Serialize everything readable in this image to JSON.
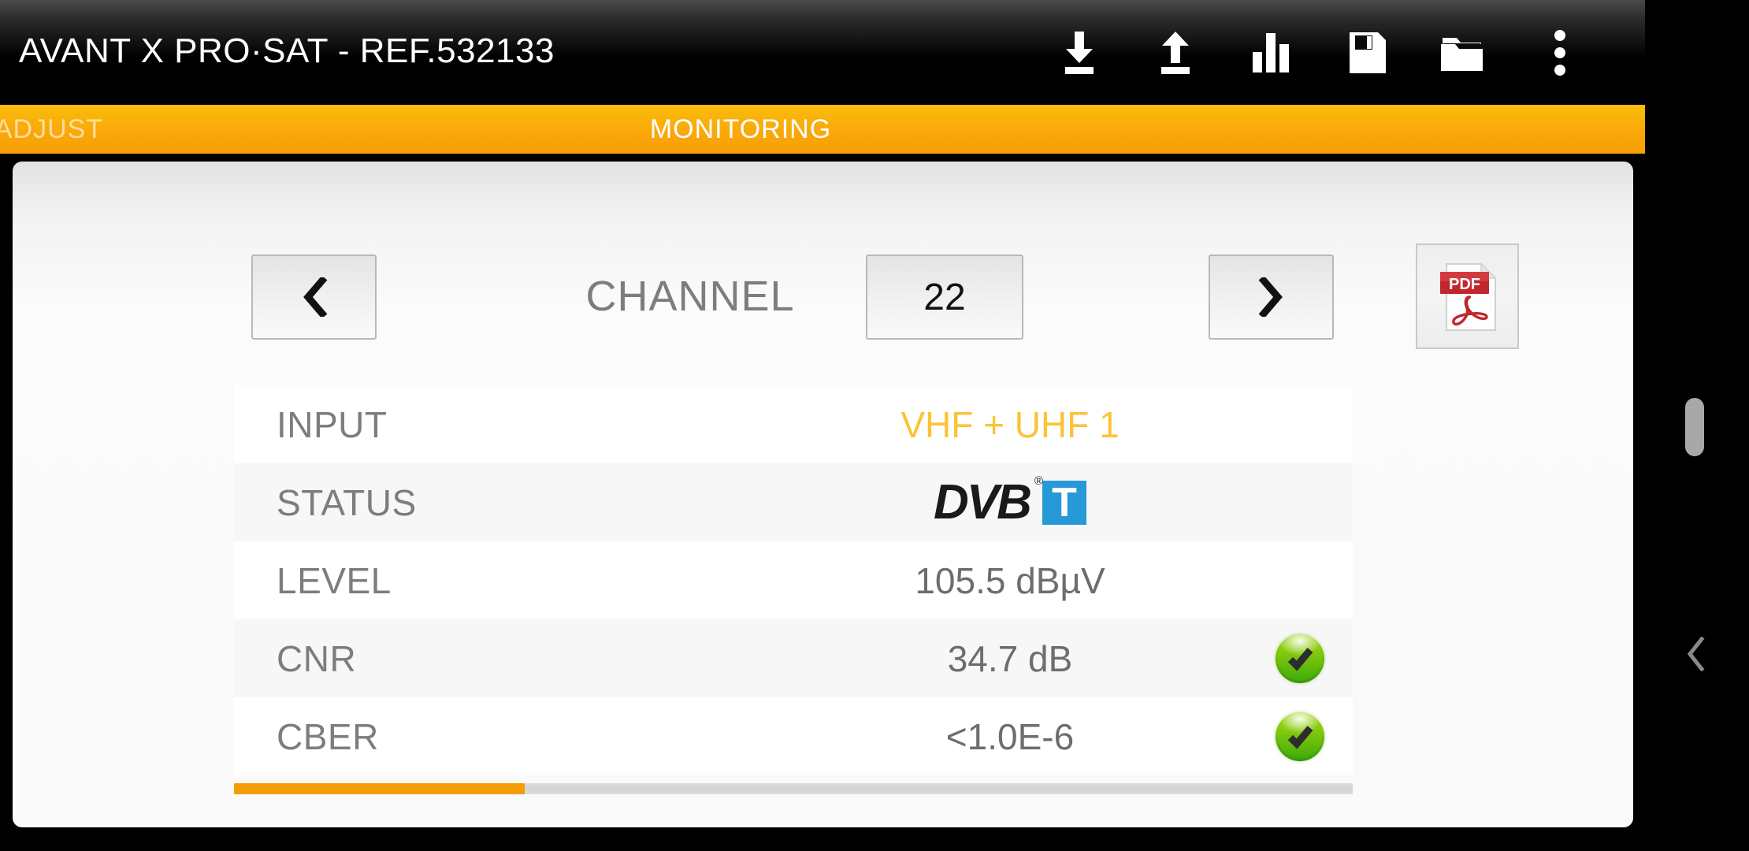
{
  "appbar": {
    "title": "AVANT X  PRO·SAT - REF.532133",
    "actions": [
      {
        "name": "download-icon",
        "label": "Download"
      },
      {
        "name": "upload-icon",
        "label": "Upload"
      },
      {
        "name": "bar-chart-icon",
        "label": "Spectrum"
      },
      {
        "name": "save-icon",
        "label": "Save"
      },
      {
        "name": "folder-icon",
        "label": "Open"
      },
      {
        "name": "more-vert-icon",
        "label": "More options"
      }
    ]
  },
  "tabs": [
    {
      "label": "ADJUST",
      "active": false
    },
    {
      "label": "MONITORING",
      "active": true
    }
  ],
  "channel": {
    "prev_label": "‹",
    "label": "CHANNEL",
    "value": "22",
    "next_label": "›",
    "pdf_label": "PDF"
  },
  "table": {
    "rows": [
      {
        "label": "INPUT",
        "value": "VHF + UHF 1",
        "accent": true,
        "badge": false,
        "logo": false
      },
      {
        "label": "STATUS",
        "value": "DVB-T",
        "accent": false,
        "badge": false,
        "logo": true
      },
      {
        "label": "LEVEL",
        "value": "105.5 dBµV",
        "accent": false,
        "badge": false,
        "logo": false
      },
      {
        "label": "CNR",
        "value": "34.7 dB",
        "accent": false,
        "badge": true,
        "logo": false
      },
      {
        "label": "CBER",
        "value": "<1.0E-6",
        "accent": false,
        "badge": true,
        "logo": false
      }
    ],
    "dvb_word": "DVB",
    "dvb_reg": "®",
    "dvb_t": "T"
  },
  "scrollbars": {
    "horizontal_percent": 26
  },
  "colors": {
    "accent_orange": "#f59c00",
    "tab_orange_top": "#fbbc0a",
    "tab_orange_bottom": "#f79e06",
    "value_amber": "#fcc336",
    "status_green": "#3aa90b",
    "dvb_blue": "#2699d6",
    "pdf_red": "#c0272d",
    "label_gray": "#7d7d7d"
  }
}
